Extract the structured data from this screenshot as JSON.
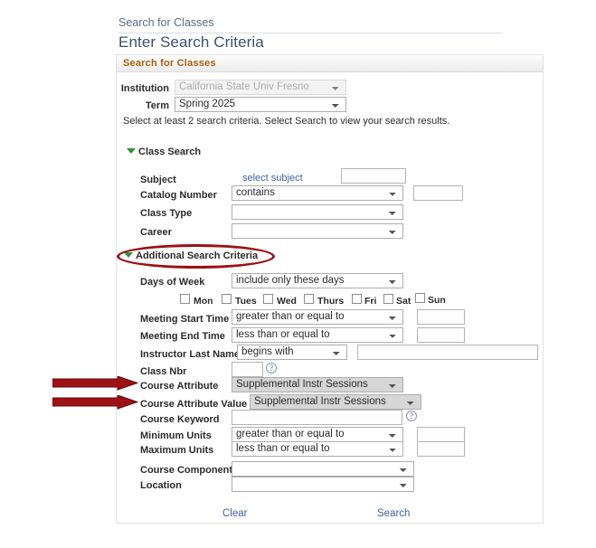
{
  "breadcrumb": {
    "label": "Search for Classes"
  },
  "page_title": "Enter Search Criteria",
  "panel": {
    "header": "Search for Classes"
  },
  "top_form": {
    "institution_label": "Institution",
    "institution_value": "California State Univ  Fresno",
    "term_label": "Term",
    "term_value": "Spring 2025",
    "instruction": "Select at least 2 search criteria. Select Search to view your search results."
  },
  "class_search": {
    "section_title": "Class Search",
    "subject_label": "Subject",
    "select_subject_link": "select subject",
    "subject_value": "",
    "catalog_number_label": "Catalog Number",
    "catalog_number_op": "contains",
    "catalog_number_value": "",
    "class_type_label": "Class Type",
    "class_type_value": "",
    "career_label": "Career",
    "career_value": ""
  },
  "additional_criteria": {
    "section_title": "Additional Search Criteria",
    "days_of_week_label": "Days of Week",
    "days_of_week_value": "include only these days",
    "day_checkboxes": [
      {
        "label": "Mon",
        "checked": false
      },
      {
        "label": "Tues",
        "checked": false
      },
      {
        "label": "Wed",
        "checked": false
      },
      {
        "label": "Thurs",
        "checked": false
      },
      {
        "label": "Fri",
        "checked": false
      },
      {
        "label": "Sat",
        "checked": false
      },
      {
        "label": "Sun",
        "checked": false
      }
    ],
    "meeting_start_label": "Meeting Start Time",
    "meeting_start_op": "greater than or equal to",
    "meeting_start_value": "",
    "meeting_end_label": "Meeting End Time",
    "meeting_end_op": "less than or equal to",
    "meeting_end_value": "",
    "instructor_label": "Instructor Last Name",
    "instructor_op": "begins with",
    "instructor_value": "",
    "class_nbr_label": "Class Nbr",
    "class_nbr_value": "",
    "class_nbr_help": "?",
    "course_attribute_label": "Course Attribute",
    "course_attribute_value": "Supplemental Instr Sessions",
    "course_attribute_value_label": "Course Attribute Value",
    "course_attribute_value_value": "Supplemental Instr Sessions",
    "course_keyword_label": "Course Keyword",
    "course_keyword_value": "",
    "course_keyword_help": "?",
    "minimum_units_label": "Minimum Units",
    "minimum_units_op": "greater than or equal to",
    "minimum_units_value": "",
    "maximum_units_label": "Maximum Units",
    "maximum_units_op": "less than or equal to",
    "maximum_units_value": "",
    "course_component_label": "Course Component",
    "course_component_value": "",
    "location_label": "Location",
    "location_value": ""
  },
  "footer": {
    "clear_label": "Clear",
    "search_label": "Search"
  },
  "annotations": {
    "ellipse_color": "#991115",
    "arrow_color": "#9e1114",
    "arrow_targets": [
      "Course Attribute",
      "Course Attribute Value"
    ]
  },
  "colors": {
    "link": "#41609b",
    "panel_header_text": "#a8600f",
    "title": "#3e4f6e",
    "section_triangle": "#2f8f3f"
  }
}
